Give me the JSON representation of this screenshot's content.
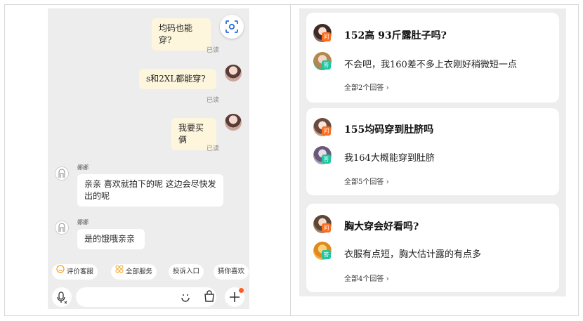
{
  "chat": {
    "messages": [
      {
        "text": "均码也能穿?",
        "status": "已读"
      },
      {
        "text": "s和2XL都能穿?",
        "status": "已读"
      },
      {
        "text": "我要买俩",
        "status": "已读"
      },
      {
        "sender": "娜娜",
        "text": "亲亲  喜欢就拍下的呢  这边会尽快发出的呢"
      },
      {
        "sender": "娜娜",
        "text": "是的饿哦亲亲"
      }
    ],
    "quick_actions": [
      "评价客服",
      "全部服务",
      "投诉入口",
      "猜你喜欢"
    ],
    "input": {
      "placeholder": ""
    }
  },
  "qa": [
    {
      "question": "152高  93斤露肚子吗?",
      "answer": "不会吧，我160差不多上衣刚好稍微短一点",
      "all": "全部2个回答"
    },
    {
      "question": "155均码穿到肚脐吗",
      "answer": "我164大概能穿到肚脐",
      "all": "全部5个回答"
    },
    {
      "question": "胸大穿会好看吗?",
      "answer": "衣服有点短，胸大估计露的有点多",
      "all": "全部4个回答"
    }
  ],
  "badges": {
    "question": "问",
    "answer": "答"
  },
  "colors": {
    "bubble_self": "#fdf6dd",
    "bubble_other": "#ffffff",
    "question_badge": "#ff6a1a",
    "answer_badge": "#1ec7a0",
    "notify_dot": "#ff5a1f"
  }
}
